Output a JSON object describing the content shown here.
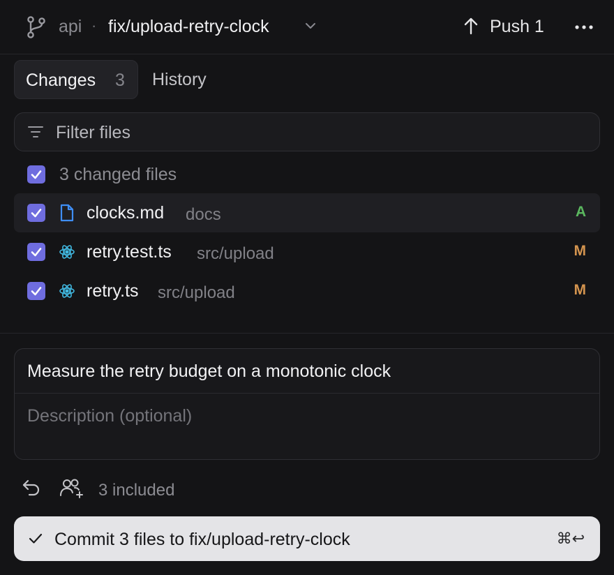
{
  "header": {
    "repo": "api",
    "separator": "·",
    "branch": "fix/upload-retry-clock",
    "push_label": "Push 1",
    "icons": [
      "git-branch-icon",
      "chevron-down-icon",
      "arrow-up-icon",
      "more-icon"
    ]
  },
  "tabs": {
    "changes_label": "Changes",
    "changes_count": "3",
    "history_label": "History"
  },
  "filter": {
    "placeholder": "Filter files"
  },
  "files": {
    "summary": "3 changed files",
    "items": [
      {
        "name": "clocks.md",
        "dir": "docs",
        "status": "A",
        "icon": "file-icon",
        "checked": true
      },
      {
        "name": "retry.test.ts",
        "dir": "src/upload",
        "status": "M",
        "icon": "react-icon",
        "checked": true
      },
      {
        "name": "retry.ts",
        "dir": "src/upload",
        "status": "M",
        "icon": "react-icon",
        "checked": true
      }
    ]
  },
  "commit": {
    "summary": "Measure the retry budget on a monotonic clock",
    "description_placeholder": "Description (optional)",
    "included": "3 included",
    "button_label": "Commit 3 files to fix/upload-retry-clock",
    "shortcut": "⌘↩"
  },
  "colors": {
    "checkbox": "#6f6ddf",
    "added": "#5bb85f",
    "modified": "#d5954f",
    "file_icon": "#3f8ef5",
    "react_icon": "#41b8e0"
  }
}
